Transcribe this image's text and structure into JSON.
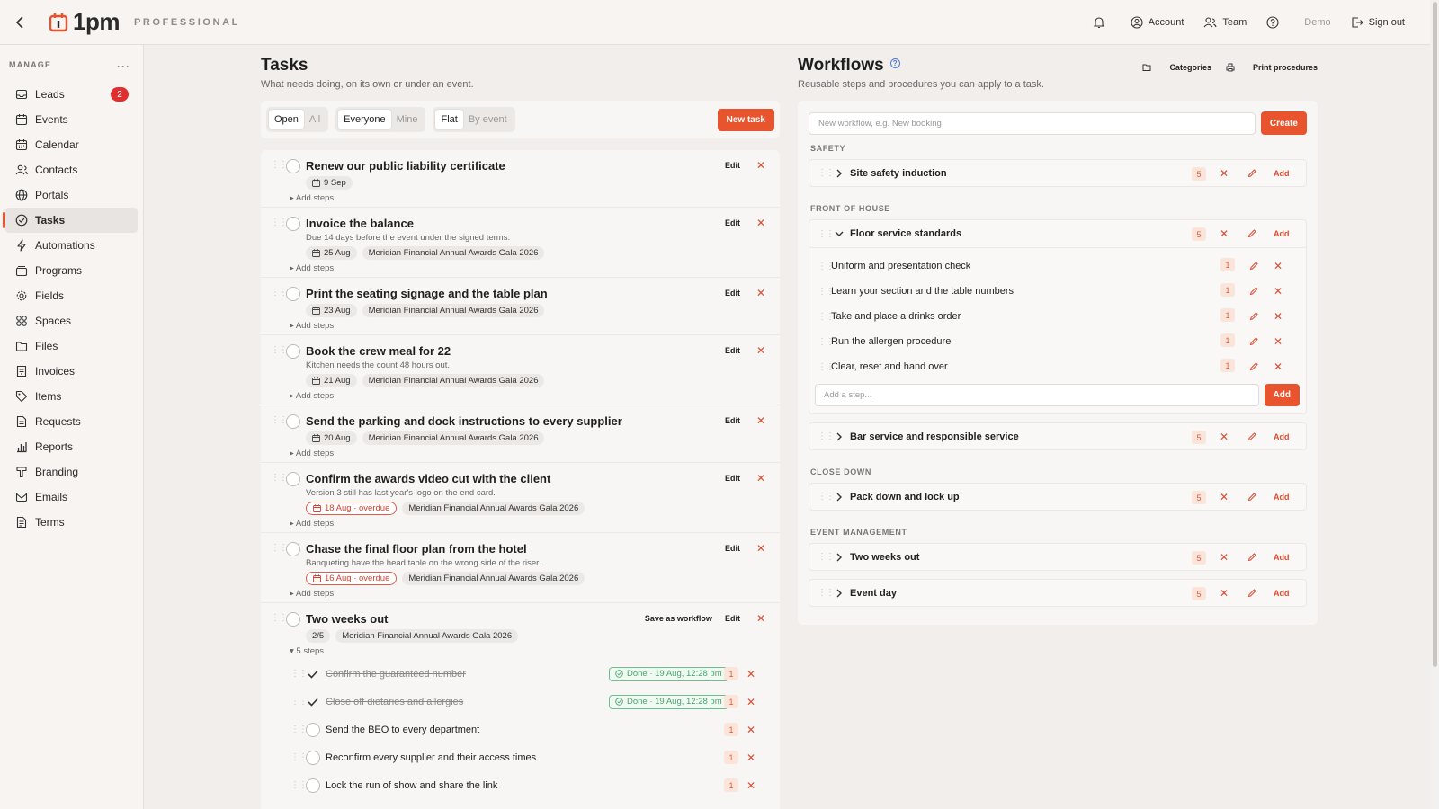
{
  "brand": {
    "name": "1pm",
    "edition": "PROFESSIONAL"
  },
  "topnav": {
    "notifications": "",
    "account": "Account",
    "team": "Team",
    "help": "",
    "demo": "Demo",
    "signout": "Sign out"
  },
  "sidebar": {
    "heading": "MANAGE",
    "more": "···",
    "items": [
      {
        "label": "Leads",
        "badge": "2"
      },
      {
        "label": "Events"
      },
      {
        "label": "Calendar"
      },
      {
        "label": "Contacts"
      },
      {
        "label": "Portals"
      },
      {
        "label": "Tasks",
        "active": true
      },
      {
        "label": "Automations"
      },
      {
        "label": "Programs"
      },
      {
        "label": "Fields"
      },
      {
        "label": "Spaces"
      },
      {
        "label": "Files"
      },
      {
        "label": "Invoices"
      },
      {
        "label": "Items"
      },
      {
        "label": "Requests"
      },
      {
        "label": "Reports"
      },
      {
        "label": "Branding"
      },
      {
        "label": "Emails"
      },
      {
        "label": "Terms"
      }
    ]
  },
  "tasks": {
    "title": "Tasks",
    "subtitle": "What needs doing, on its own or under an event.",
    "filters": {
      "status": [
        "Open",
        "All"
      ],
      "owner": [
        "Everyone",
        "Mine"
      ],
      "view": [
        "Flat",
        "By event"
      ]
    },
    "new_task": "New task",
    "edit": "Edit",
    "add_steps": "▸ Add steps",
    "items": [
      {
        "title": "Renew our public liability certificate",
        "desc": "",
        "date": "9 Sep",
        "overdue": false,
        "event": ""
      },
      {
        "title": "Invoice the balance",
        "desc": "Due 14 days before the event under the signed terms.",
        "date": "25 Aug",
        "overdue": false,
        "event": "Meridian Financial Annual Awards Gala 2026"
      },
      {
        "title": "Print the seating signage and the table plan",
        "desc": "",
        "date": "23 Aug",
        "overdue": false,
        "event": "Meridian Financial Annual Awards Gala 2026"
      },
      {
        "title": "Book the crew meal for 22",
        "desc": "Kitchen needs the count 48 hours out.",
        "date": "21 Aug",
        "overdue": false,
        "event": "Meridian Financial Annual Awards Gala 2026"
      },
      {
        "title": "Send the parking and dock instructions to every supplier",
        "desc": "",
        "date": "20 Aug",
        "overdue": false,
        "event": "Meridian Financial Annual Awards Gala 2026"
      },
      {
        "title": "Confirm the awards video cut with the client",
        "desc": "Version 3 still has last year's logo on the end card.",
        "date": "18 Aug · overdue",
        "overdue": true,
        "event": "Meridian Financial Annual Awards Gala 2026"
      },
      {
        "title": "Chase the final floor plan from the hotel",
        "desc": "Banqueting have the head table on the wrong side of the riser.",
        "date": "16 Aug · overdue",
        "overdue": true,
        "event": "Meridian Financial Annual Awards Gala 2026"
      }
    ],
    "workflow_task": {
      "title": "Two weeks out",
      "progress": "2/5",
      "event": "Meridian Financial Annual Awards Gala 2026",
      "save_as_workflow": "Save as workflow",
      "steps_toggle": "▾ 5 steps",
      "steps": [
        {
          "label": "Confirm the guaranteed number",
          "done": true,
          "done_label": "Done · 19 Aug, 12:28 pm",
          "count": "1"
        },
        {
          "label": "Close off dietaries and allergies",
          "done": true,
          "done_label": "Done · 19 Aug, 12:28 pm",
          "count": "1"
        },
        {
          "label": "Send the BEO to every department",
          "done": false,
          "count": "1"
        },
        {
          "label": "Reconfirm every supplier and their access times",
          "done": false,
          "count": "1"
        },
        {
          "label": "Lock the run of show and share the link",
          "done": false,
          "count": "1"
        }
      ]
    }
  },
  "workflows": {
    "title": "Workflows",
    "subtitle": "Reusable steps and procedures you can apply to a task.",
    "categories_btn": "Categories",
    "print_btn": "Print procedures",
    "new_placeholder": "New workflow, e.g. New booking",
    "create": "Create",
    "add": "Add",
    "add_step_placeholder": "Add a step...",
    "groups": [
      {
        "category": "SAFETY",
        "items": [
          {
            "name": "Site safety induction",
            "count": "5"
          }
        ]
      },
      {
        "category": "FRONT OF HOUSE",
        "items": [
          {
            "name": "Floor service standards",
            "count": "5",
            "expanded": true,
            "steps": [
              {
                "name": "Uniform and presentation check",
                "count": "1"
              },
              {
                "name": "Learn your section and the table numbers",
                "count": "1"
              },
              {
                "name": "Take and place a drinks order",
                "count": "1"
              },
              {
                "name": "Run the allergen procedure",
                "count": "1"
              },
              {
                "name": "Clear, reset and hand over",
                "count": "1"
              }
            ]
          },
          {
            "name": "Bar service and responsible service",
            "count": "5"
          }
        ]
      },
      {
        "category": "CLOSE DOWN",
        "items": [
          {
            "name": "Pack down and lock up",
            "count": "5"
          }
        ]
      },
      {
        "category": "EVENT MANAGEMENT",
        "items": [
          {
            "name": "Two weeks out",
            "count": "5"
          },
          {
            "name": "Event day",
            "count": "5"
          }
        ]
      }
    ]
  },
  "colors": {
    "accent": "#e8542d",
    "badge": "#e02f2f",
    "done": "#47a56a"
  }
}
